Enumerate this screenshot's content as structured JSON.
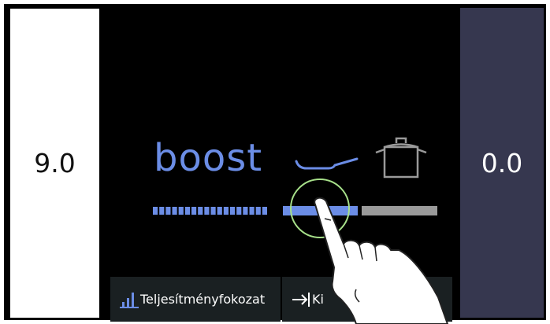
{
  "left_panel": {
    "value": "9.0"
  },
  "right_panel": {
    "value": "0.0"
  },
  "mode": {
    "label": "boost"
  },
  "icons": {
    "pan": "frying-pan-icon",
    "pot": "cooking-pot-icon",
    "power": "bar-chart-icon",
    "timer": "arrow-to-bar-icon"
  },
  "buttons": {
    "power_level_label": "Teljesítményfokozat",
    "timer_label": "Ki"
  },
  "colors": {
    "accent": "#6b8de6",
    "slider_inactive": "#9a9a9a",
    "right_panel": "#36374f",
    "touch_ring": "#a7e08a"
  }
}
